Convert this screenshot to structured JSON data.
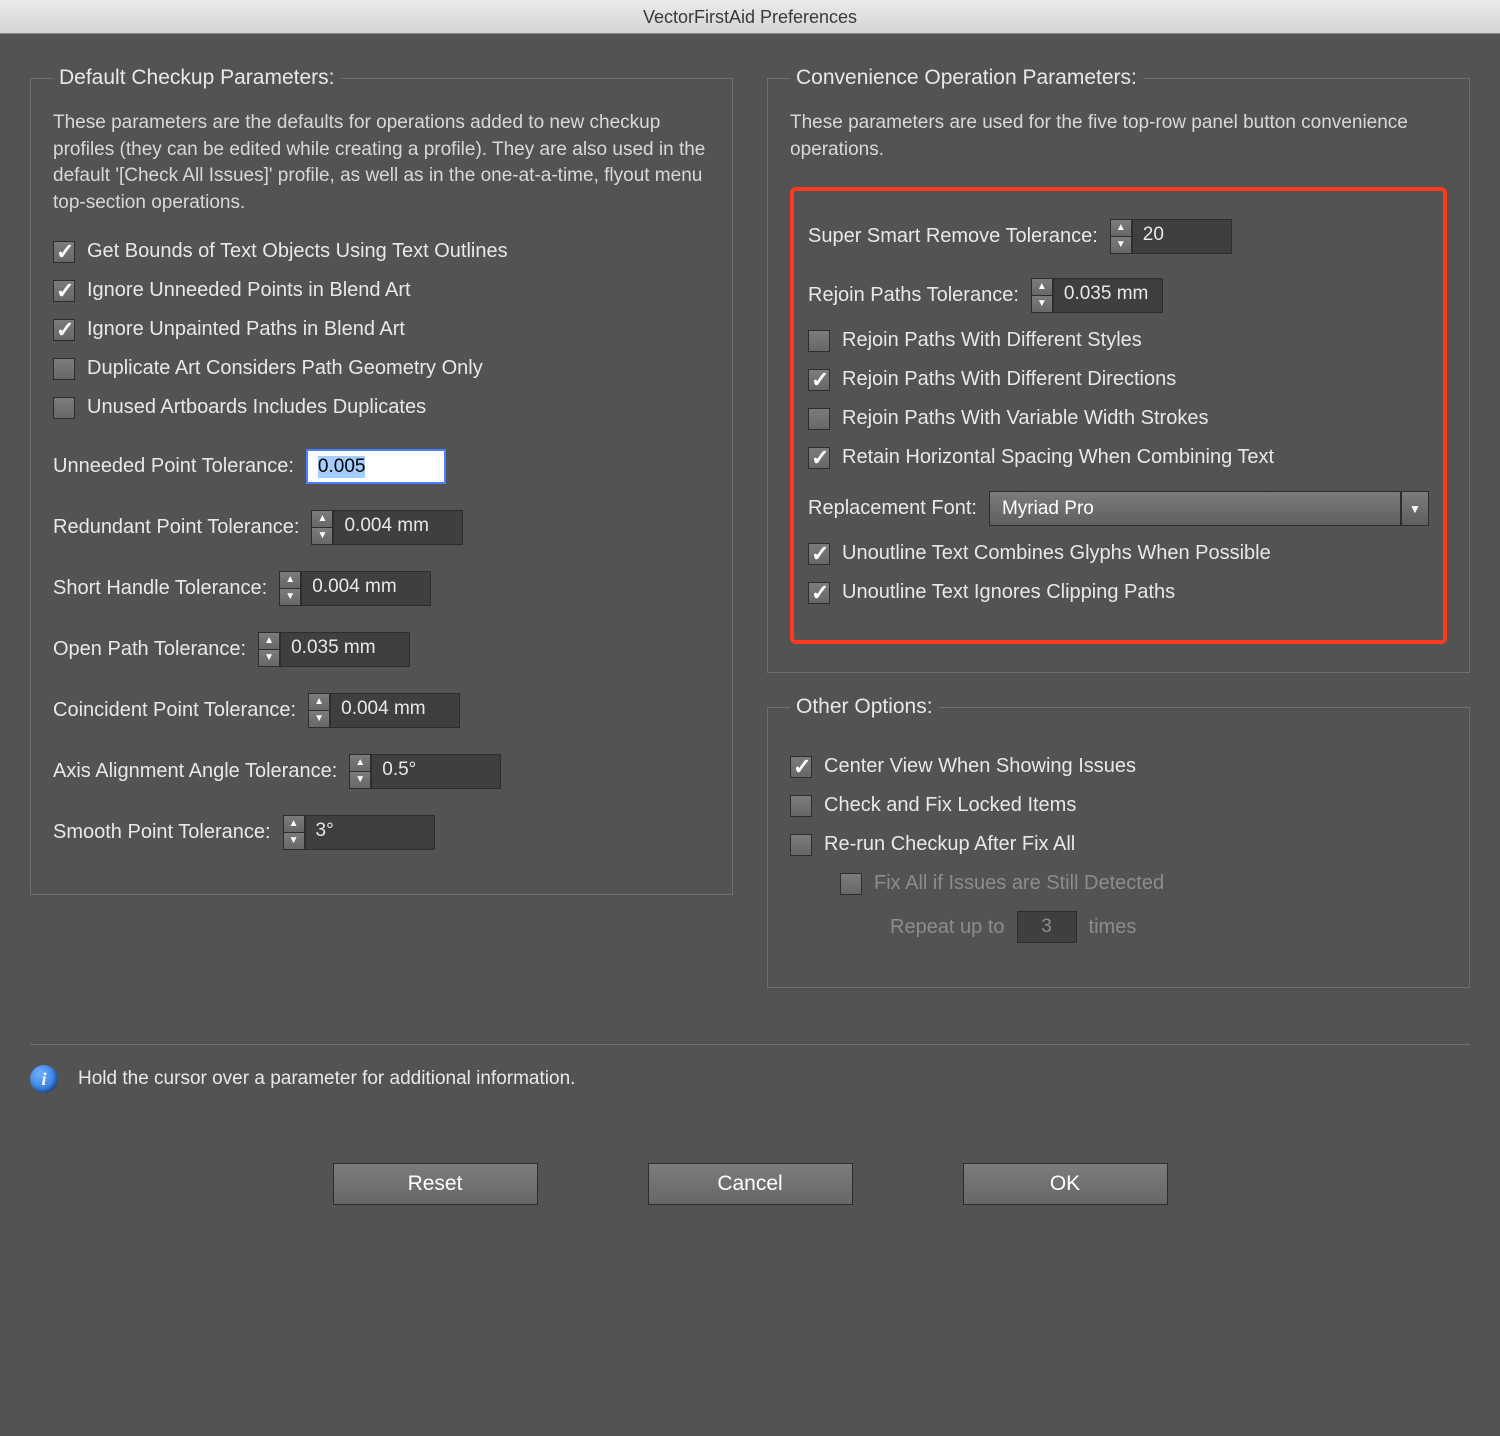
{
  "window_title": "VectorFirstAid Preferences",
  "left": {
    "legend": "Default Checkup Parameters:",
    "desc": "These parameters are the defaults for operations added to new checkup profiles (they can be edited while creating a profile). They are also used in the default '[Check All Issues]' profile, as well as in the one-at-a-time, flyout menu top-section operations.",
    "checks": {
      "bounds": "Get Bounds of Text Objects Using Text Outlines",
      "ignore_points": "Ignore Unneeded Points in Blend Art",
      "ignore_unpainted": "Ignore Unpainted Paths in Blend Art",
      "dup_geom": "Duplicate Art Considers Path Geometry Only",
      "unused_ab": "Unused Artboards Includes Duplicates"
    },
    "tolerances": {
      "unneeded": {
        "label": "Unneeded Point Tolerance:",
        "value": "0.005"
      },
      "redundant": {
        "label": "Redundant Point Tolerance:",
        "value": "0.004 mm"
      },
      "short_handle": {
        "label": "Short Handle Tolerance:",
        "value": "0.004 mm"
      },
      "open_path": {
        "label": "Open Path Tolerance:",
        "value": "0.035 mm"
      },
      "coincident": {
        "label": "Coincident Point Tolerance:",
        "value": "0.004 mm"
      },
      "axis": {
        "label": "Axis Alignment Angle Tolerance:",
        "value": "0.5°"
      },
      "smooth": {
        "label": "Smooth Point Tolerance:",
        "value": "3°"
      }
    }
  },
  "right": {
    "conv": {
      "legend": "Convenience Operation Parameters:",
      "desc": "These parameters are used for the five top-row panel button convenience operations.",
      "ssr": {
        "label": "Super Smart Remove Tolerance:",
        "value": "20"
      },
      "rejoin_tol": {
        "label": "Rejoin Paths Tolerance:",
        "value": "0.035 mm"
      },
      "rejoin_styles": "Rejoin Paths With Different Styles",
      "rejoin_dirs": "Rejoin Paths With Different Directions",
      "rejoin_vw": "Rejoin Paths With Variable Width Strokes",
      "retain_spacing": "Retain Horizontal Spacing When Combining Text",
      "font": {
        "label": "Replacement Font:",
        "value": "Myriad Pro"
      },
      "unoutline_glyphs": "Unoutline Text Combines Glyphs When Possible",
      "unoutline_clip": "Unoutline Text Ignores Clipping Paths"
    },
    "other": {
      "legend": "Other Options:",
      "center": "Center View When Showing Issues",
      "locked": "Check and Fix Locked Items",
      "rerun": "Re-run Checkup After Fix All",
      "fixall_detected": "Fix All if Issues are Still Detected",
      "repeat_label_pre": "Repeat up to",
      "repeat_value": "3",
      "repeat_label_post": "times"
    }
  },
  "info": "Hold the cursor over a parameter for additional information.",
  "buttons": {
    "reset": "Reset",
    "cancel": "Cancel",
    "ok": "OK"
  }
}
